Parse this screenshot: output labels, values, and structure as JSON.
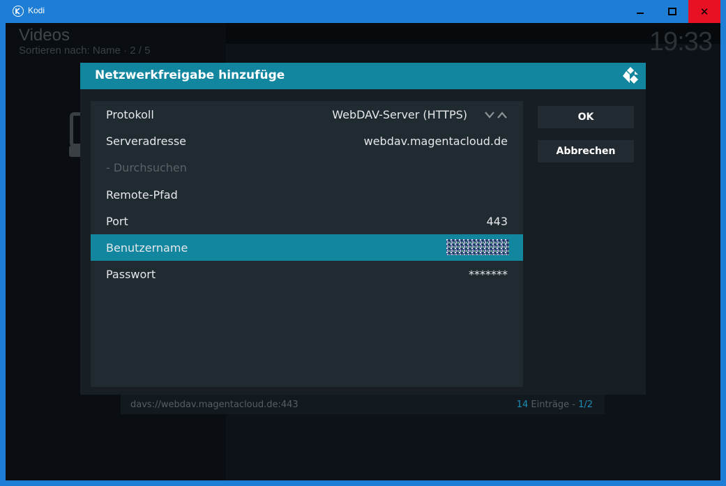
{
  "window": {
    "title": "Kodi",
    "close_glyph": "✕",
    "colors": {
      "titlebar": "#1e7ed6",
      "close": "#e81123"
    }
  },
  "background": {
    "title": "Videos",
    "sort_label": "Sortieren nach: Name  ·  2 / 5",
    "clock": "19:33",
    "footer_path": "davs://webdav.magentacloud.de:443",
    "footer_count_num": "14",
    "footer_count_text": " Einträge - ",
    "footer_page": "1/2"
  },
  "dialog": {
    "title": "Netzwerkfreigabe hinzufüge",
    "accent": "#12859f",
    "fields": [
      {
        "label": "Protokoll",
        "value": "WebDAV-Server (HTTPS)"
      },
      {
        "label": "Serveradresse",
        "value": "webdav.magentacloud.de"
      },
      {
        "label": "- Durchsuchen",
        "value": ""
      },
      {
        "label": "Remote-Pfad",
        "value": ""
      },
      {
        "label": "Port",
        "value": "443"
      },
      {
        "label": "Benutzername",
        "value": ""
      },
      {
        "label": "Passwort",
        "value": "*******"
      }
    ],
    "ok_label": "OK",
    "cancel_label": "Abbrechen"
  }
}
